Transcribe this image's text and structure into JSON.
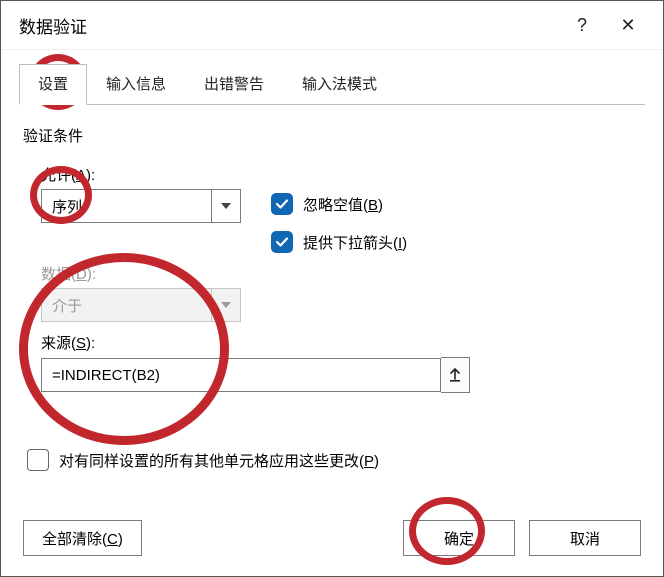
{
  "title": "数据验证",
  "help_symbol": "?",
  "close_symbol": "✕",
  "tabs": {
    "settings": "设置",
    "input_msg": "输入信息",
    "error_alert": "出错警告",
    "ime_mode": "输入法模式"
  },
  "labels": {
    "criteria_group": "验证条件",
    "allow_prefix": "允许(",
    "allow_key": "A",
    "allow_suffix": "):",
    "data_prefix": "数据(",
    "data_key": "D",
    "data_suffix": "):",
    "source_prefix": "来源(",
    "source_key": "S",
    "source_suffix": "):",
    "ignore_blank_prefix": "忽略空值(",
    "ignore_blank_key": "B",
    "ignore_blank_suffix": ")",
    "dropdown_prefix": "提供下拉箭头(",
    "dropdown_key": "I",
    "dropdown_suffix": ")",
    "apply_prefix": "对有同样设置的所有其他单元格应用这些更改(",
    "apply_key": "P",
    "apply_suffix": ")"
  },
  "values": {
    "allow": "序列",
    "data": "介于",
    "source": "=INDIRECT(B2)",
    "ignore_blank_checked": true,
    "dropdown_checked": true,
    "apply_checked": false
  },
  "buttons": {
    "clear_all_prefix": "全部清除(",
    "clear_all_key": "C",
    "clear_all_suffix": ")",
    "ok": "确定",
    "cancel": "取消"
  }
}
